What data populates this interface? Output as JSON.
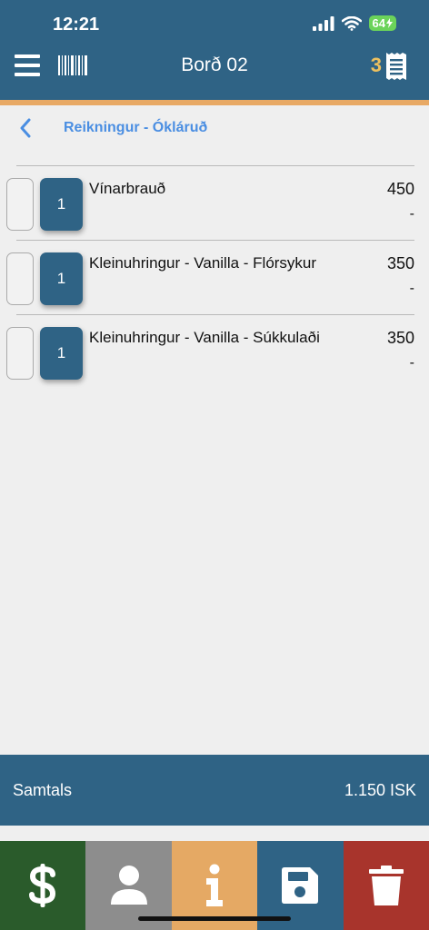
{
  "status": {
    "time": "12:21",
    "battery": "64"
  },
  "header": {
    "title": "Borð 02",
    "ticket_count": "3"
  },
  "breadcrumb": {
    "label": "Reikningur - Ókláruð"
  },
  "items": [
    {
      "qty": "1",
      "name": "Vínarbrauð",
      "price": "450",
      "discount": "-"
    },
    {
      "qty": "1",
      "name": "Kleinuhringur - Vanilla - Flórsykur",
      "price": "350",
      "discount": "-"
    },
    {
      "qty": "1",
      "name": "Kleinuhringur - Vanilla - Súkkulaði",
      "price": "350",
      "discount": "-"
    }
  ],
  "total": {
    "label": "Samtals",
    "value": "1.150 ISK"
  },
  "actions": [
    {
      "icon": "dollar-icon",
      "color": "#2a5b2b"
    },
    {
      "icon": "person-icon",
      "color": "#8d8d8d"
    },
    {
      "icon": "info-icon",
      "color": "#e5a964"
    },
    {
      "icon": "save-icon",
      "color": "#2f6385"
    },
    {
      "icon": "trash-icon",
      "color": "#a8342c"
    }
  ],
  "colors": {
    "primary": "#2f6385",
    "accent": "#e8a965",
    "link": "#4a8ee2",
    "count": "#ecc05f"
  }
}
